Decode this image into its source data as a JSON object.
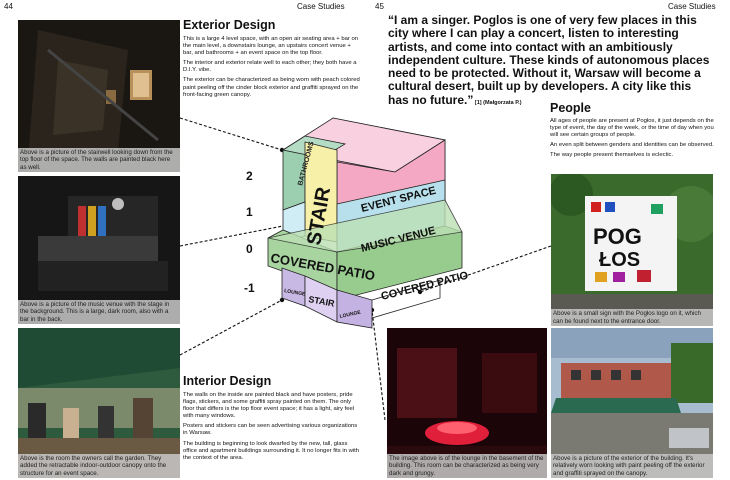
{
  "header": {
    "left_page": "44",
    "left_section": "Case Studies",
    "right_page": "45",
    "right_section": "Case Studies"
  },
  "exterior": {
    "title": "Exterior Design",
    "p1": "This is a large 4 level space, with an open air seating area + bar on the main level, a downstairs lounge, an upstairs concert venue + bar, and bathrooms + an event space on the top floor.",
    "p2": "The interior and exterior relate well to each other; they both have a D.I.Y. vibe.",
    "p3": "The exterior can be characterized as being worn with peach colored paint peeling off the cinder block exterior and graffiti sprayed on the front-facing green canopy."
  },
  "interior": {
    "title": "Interior Design",
    "p1": "The walls on the inside are painted black and have posters, pride flags, stickers, and some graffiti spray painted on them. The only floor that differs is the top floor event space; it has a light, airy feel with many windows.",
    "p2": "Posters and stickers can be seen advertising various organizations in Warsaw.",
    "p3": "The building is beginning to look dwarfed by the new, tall, glass office and apartment buildings surrounding it. It no longer fits in with the context of the area."
  },
  "quote": {
    "text": "“I am a singer. Poglos is one of very few places in this city where I can play a concert, listen to interesting artists, and come into contact with an ambitiously independent culture. These kinds of autonomous places need to be protected. Without it, Warsaw will become a cultural desert, built up by developers. A city like this has no future.”",
    "ref": "[1]",
    "author": "(Małgorzata P.)"
  },
  "people": {
    "title": "People",
    "p1": "All ages of people are present at Pogłos, it just depends on the type of event, the day of the week, or the time of day when you will see certain groups of people.",
    "p2": "An even split between genders and identities can be observed.",
    "p3": "The way people present themselves is eclectic."
  },
  "captions": {
    "stairwell": "Above is a picture of the stairwell looking down from the top floor of the space. The walls are painted black here as well.",
    "music": "Above is a picture of the music venue with the stage in the background. This is a large, dark room, also with a bar in the back.",
    "garden": "Above is the room the owners call the garden. They added the retractable indoor-outdoor canopy onto the structure for an event space.",
    "lounge": "The image above is of the lounge in the basement of the building. This room can be characterized as being very dark and grungy.",
    "sign": "Above is a small sign with the Pogłos logo on it, which can be found next to the entrance door.",
    "exterior": "Above is a picture of the exterior of the building. It's relatively worn looking with paint peeling off the exterior and graffiti sprayed on the canopy."
  },
  "diagram": {
    "level_labels": [
      "2",
      "1",
      "0",
      "-1"
    ],
    "bathrooms": "BATHROOMS",
    "stair": "STAIR",
    "event_space": "EVENT SPACE",
    "music_venue": "MUSIC VENUE",
    "covered_patio_left": "COVERED PATIO",
    "covered_patio_right": "COVERED PATIO",
    "lounge_left": "LOUNGE",
    "stair_lower": "STAIR",
    "lounge_right": "LOUNGE"
  },
  "sign_text": {
    "line1": "POG",
    "line2": "ŁOS"
  }
}
